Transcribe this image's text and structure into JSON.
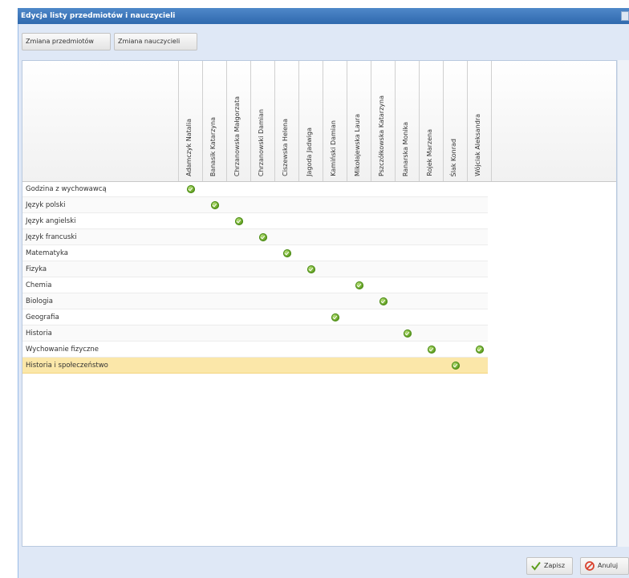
{
  "window": {
    "title": "Edycja listy przedmiotów i nauczycieli"
  },
  "toolbar": {
    "subjects_button": "Zmiana przedmiotów",
    "teachers_button": "Zmiana nauczycieli"
  },
  "grid": {
    "teachers": [
      "Adamczyk Natalia",
      "Banasik Katarzyna",
      "Chrzanowska Małgorzata",
      "Chrzanowski Damian",
      "Ciszewska Helena",
      "Jagoda Jadwiga",
      "Kamiński Damian",
      "Mikołajewska Laura",
      "Pszczółkowska Katarzyna",
      "Ranarska Monika",
      "Rojek Marzena",
      "Ślak Konrad",
      "Wójciak Aleksandra"
    ],
    "subjects": [
      {
        "name": "Godzina z wychowawcą",
        "assigned": [
          0
        ]
      },
      {
        "name": "Język polski",
        "assigned": [
          1
        ]
      },
      {
        "name": "Język angielski",
        "assigned": [
          2
        ]
      },
      {
        "name": "Język francuski",
        "assigned": [
          3
        ]
      },
      {
        "name": "Matematyka",
        "assigned": [
          4
        ]
      },
      {
        "name": "Fizyka",
        "assigned": [
          5
        ]
      },
      {
        "name": "Chemia",
        "assigned": [
          7
        ]
      },
      {
        "name": "Biologia",
        "assigned": [
          8
        ]
      },
      {
        "name": "Geografia",
        "assigned": [
          6
        ]
      },
      {
        "name": "Historia",
        "assigned": [
          9
        ]
      },
      {
        "name": "Wychowanie fizyczne",
        "assigned": [
          10,
          12
        ]
      },
      {
        "name": "Historia i społeczeństwo",
        "assigned": [
          11
        ],
        "selected": true
      }
    ]
  },
  "footer": {
    "save_button": "Zapisz",
    "cancel_button": "Anuluj"
  },
  "colors": {
    "title_bar": "#2f69ae",
    "selected_row": "#fbe7a9",
    "check_green": "#5e9e1e",
    "cancel_red": "#d9432f"
  },
  "icons": {
    "check": "check-circle-icon",
    "save": "checkmark-icon",
    "cancel": "cancel-icon",
    "close": "close-icon"
  }
}
